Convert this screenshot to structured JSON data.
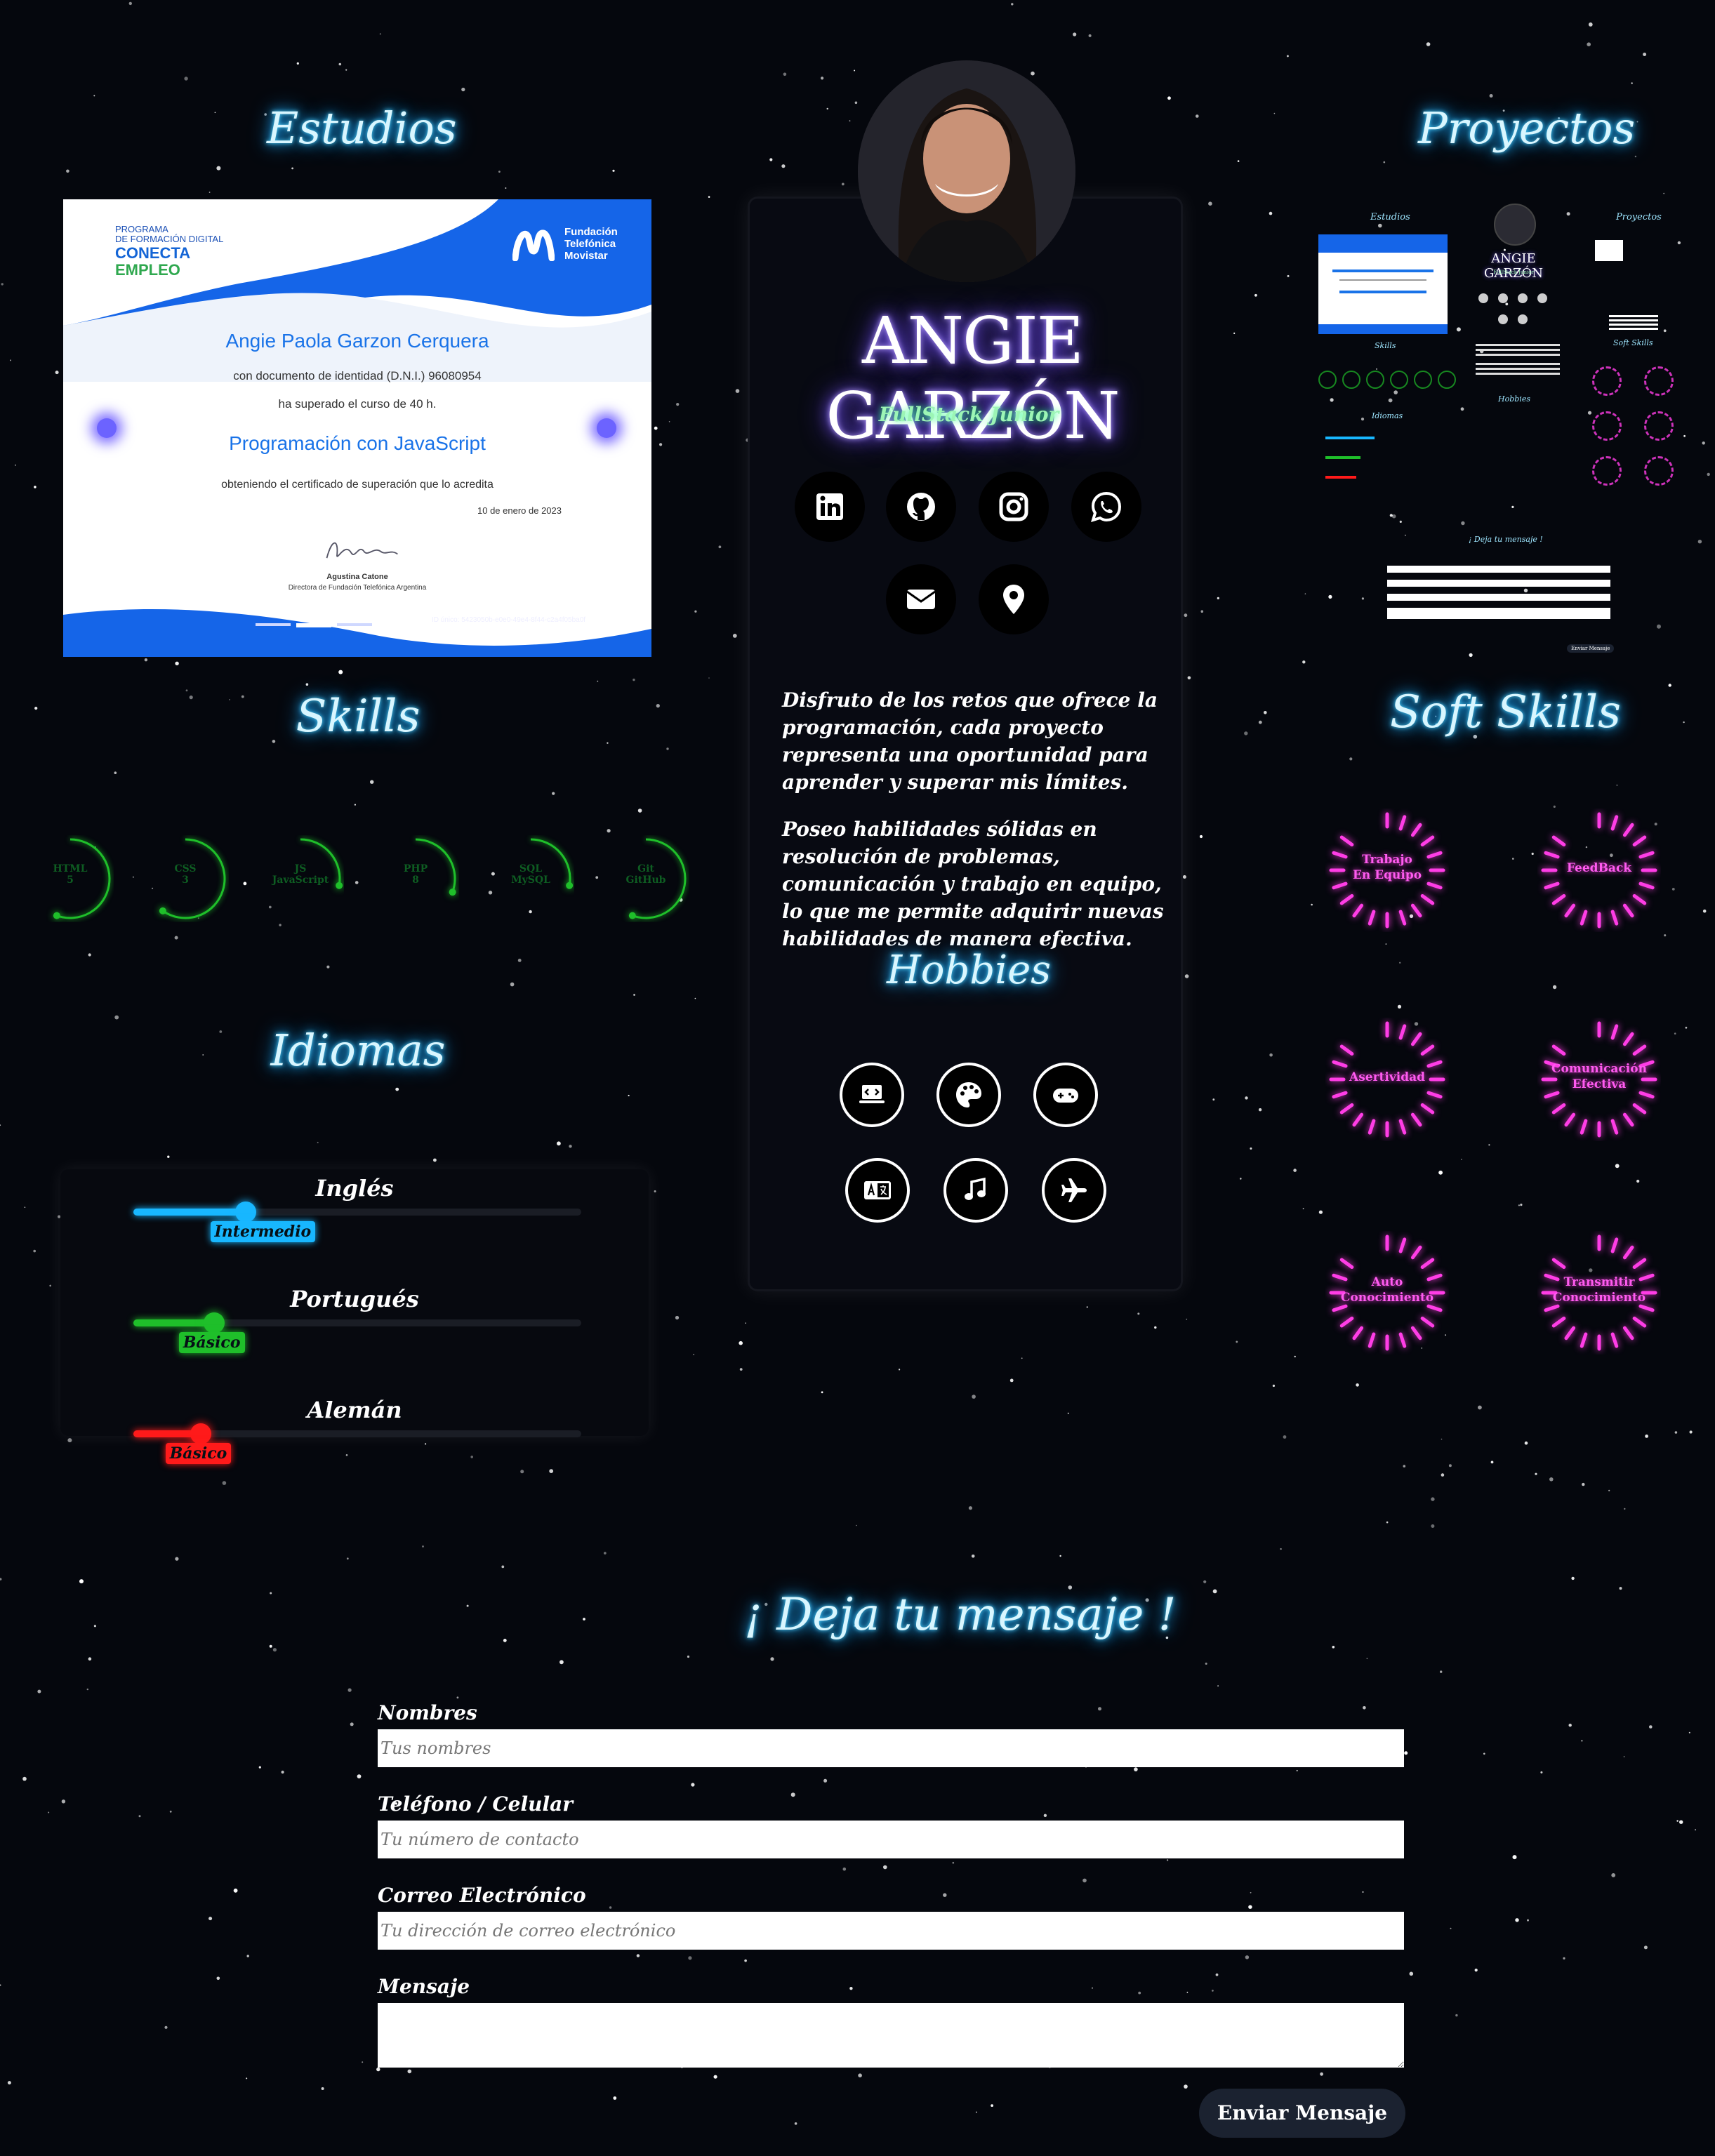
{
  "sections": {
    "estudios": "Estudios",
    "proyectos": "Proyectos",
    "skills": "Skills",
    "soft_skills": "Soft Skills",
    "idiomas": "Idiomas",
    "hobbies": "Hobbies",
    "contact": "¡ Deja tu mensaje !"
  },
  "certificate": {
    "program_label_1": "PROGRAMA",
    "program_label_2": "DE FORMACIÓN DIGITAL",
    "brand_1": "CONECTA",
    "brand_2": "EMPLEO",
    "org_1": "Fundación",
    "org_2": "Telefónica",
    "org_3": "Movistar",
    "student": "Angie Paola Garzon Cerquera",
    "id_line": "con documento de identidad (D.N.I.) 96080954",
    "hours_line": "ha superado el curso de 40 h.",
    "course": "Programación con JavaScript",
    "outcome_line": "obteniendo el certificado de superación que lo acredita",
    "date": "10 de enero de 2023",
    "signer_name": "Agustina Catone",
    "signer_role": "Directora de Fundación Telefónica Argentina",
    "code": "ID único: 5423050b-e0e0-49e4-8f44-c2a4f05ba0f"
  },
  "profile": {
    "name": "ANGIE GARZÓN",
    "role": "FullStack Junior",
    "bio_1": "Disfruto de los retos que ofrece la programación, cada proyecto representa una oportunidad para aprender y superar mis límites.",
    "bio_2": "Poseo habilidades sólidas en resolución de problemas, comunicación y trabajo en equipo, lo que me permite adquirir nuevas habilidades de manera efectiva."
  },
  "social": [
    "linkedin-icon",
    "github-icon",
    "instagram-icon",
    "whatsapp-icon",
    "email-icon",
    "location-icon"
  ],
  "hobbies": [
    "laptop-code-icon",
    "palette-icon",
    "gamepad-icon",
    "language-icon",
    "music-icon",
    "plane-icon"
  ],
  "skills": [
    {
      "l1": "HTML",
      "l2": "5"
    },
    {
      "l1": "CSS",
      "l2": "3"
    },
    {
      "l1": "JS",
      "l2": "JavaScript"
    },
    {
      "l1": "PHP",
      "l2": "8"
    },
    {
      "l1": "SQL",
      "l2": "MySQL"
    },
    {
      "l1": "Git",
      "l2": "GitHub"
    }
  ],
  "languages": [
    {
      "name": "Inglés",
      "level": "Intermedio",
      "value": 0.25,
      "color": "#18b7ff"
    },
    {
      "name": "Portugués",
      "level": "Básico",
      "value": 0.18,
      "color": "#1fbf2a"
    },
    {
      "name": "Alemán",
      "level": "Básico",
      "value": 0.15,
      "color": "#ff1a1a"
    }
  ],
  "soft_skills": [
    {
      "l1": "Trabajo",
      "l2": "En Equipo"
    },
    {
      "l1": "FeedBack",
      "l2": ""
    },
    {
      "l1": "Asertividad",
      "l2": ""
    },
    {
      "l1": "Comunicación",
      "l2": "Efectiva"
    },
    {
      "l1": "Auto",
      "l2": "Conocimiento"
    },
    {
      "l1": "Transmitir",
      "l2": "Conocimiento"
    }
  ],
  "form": {
    "name_label": "Nombres",
    "name_placeholder": "Tus nombres",
    "phone_label": "Teléfono / Celular",
    "phone_placeholder": "Tu número de contacto",
    "email_label": "Correo Electrónico",
    "email_placeholder": "Tu dirección de correo electrónico",
    "message_label": "Mensaje",
    "message_placeholder": "",
    "submit": "Enviar Mensaje"
  },
  "project_thumb": {
    "t_estudios": "Estudios",
    "t_proyectos": "Proyectos",
    "t_name": "ANGIE GARZÓN",
    "t_role": "FullStack Junior",
    "t_skills": "Skills",
    "t_soft": "Soft Skills",
    "t_idiomas": "Idiomas",
    "t_hobbies": "Hobbies",
    "t_contact": "¡ Deja tu mensaje !",
    "t_send": "Enviar Mensaje"
  },
  "colors": {
    "background": "#05070d",
    "neon_blue": "#1aa8ff",
    "neon_purple": "#7a5cff",
    "neon_green": "#1fbf2a",
    "neon_pink": "#ff3de6",
    "role_green": "#9cf5b5"
  }
}
